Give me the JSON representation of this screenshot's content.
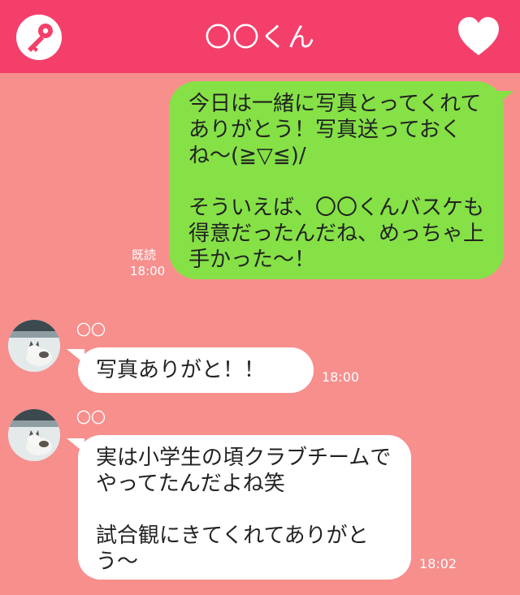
{
  "header": {
    "title": "〇〇くん",
    "bg_color": "#f43f6b",
    "left_icon": "key-icon",
    "right_icon": "heart-icon"
  },
  "background_color": "#f78f8d",
  "messages": [
    {
      "from": "me",
      "text": "今日は一緒に写真とってくれてありがとう！写真送っておくね〜(≧▽≦)/\n\nそういえば、〇〇くんバスケも得意だったんだね、めっちゃ上手かった〜！",
      "read_label": "既読",
      "time": "18:00",
      "bubble_color": "#85e146"
    },
    {
      "from": "them",
      "sender": "〇〇",
      "text": "写真ありがと！！",
      "time": "18:00"
    },
    {
      "from": "them",
      "sender": "〇〇",
      "text": "実は小学生の頃クラブチームでやってたんだよね笑\n\n試合観にきてくれてありがとう〜",
      "time": "18:02"
    }
  ]
}
